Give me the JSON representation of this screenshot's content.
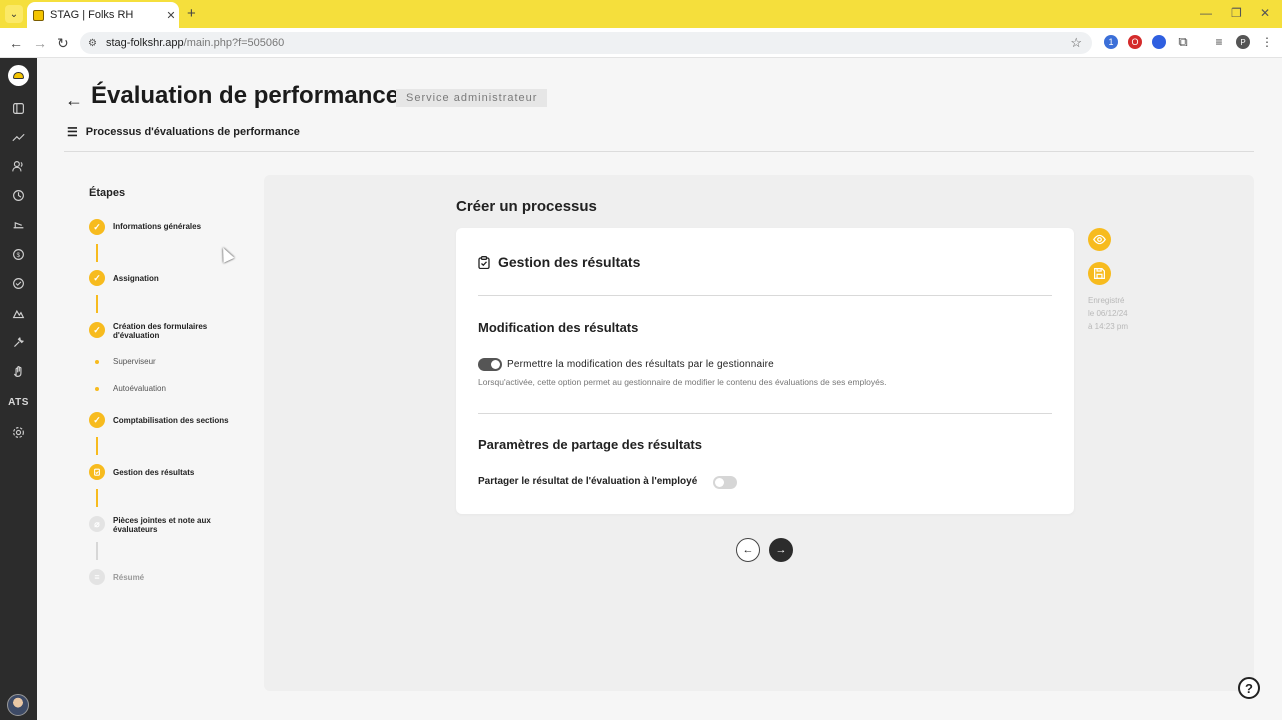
{
  "browser": {
    "tab_title": "STAG | Folks RH",
    "url_host": "stag-folkshr.app",
    "url_path": "/main.php?f=505060"
  },
  "app_sidebar": {
    "ats_label": "ATS"
  },
  "header": {
    "title": "Évaluation de performance",
    "badge": "Service administrateur",
    "sub_link": "Processus d'évaluations de performance"
  },
  "stepper": {
    "title": "Étapes",
    "steps": [
      {
        "label": "Informations générales",
        "status": "done"
      },
      {
        "label": "Assignation",
        "status": "done"
      },
      {
        "label": "Création des formulaires d'évaluation",
        "status": "done"
      },
      {
        "label": "Comptabilisation des sections",
        "status": "done"
      },
      {
        "label": "Gestion des résultats",
        "status": "current"
      },
      {
        "label": "Pièces jointes et note aux évaluateurs",
        "status": "pending"
      },
      {
        "label": "Résumé",
        "status": "pending"
      }
    ],
    "substeps": [
      "Superviseur",
      "Autoévaluation"
    ]
  },
  "main": {
    "panel_title": "Créer un processus",
    "card_title": "Gestion des résultats",
    "section1": {
      "title": "Modification des résultats",
      "option_label": "Permettre la modification des résultats par le gestionnaire",
      "option_help": "Lorsqu'activée, cette option permet au gestionnaire de modifier le contenu des évaluations de ses employés.",
      "option_enabled": true
    },
    "section2": {
      "title": "Paramètres de partage des résultats",
      "share_label": "Partager le résultat de l'évaluation à l'employé",
      "share_enabled": false
    },
    "saved": {
      "line1": "Enregistré",
      "line2": "le 06/12/24",
      "line3": "à 14:23 pm"
    }
  },
  "colors": {
    "accent": "#f7bb1e",
    "sidebar": "#2c2c2c",
    "chrome": "#f5df3c"
  }
}
